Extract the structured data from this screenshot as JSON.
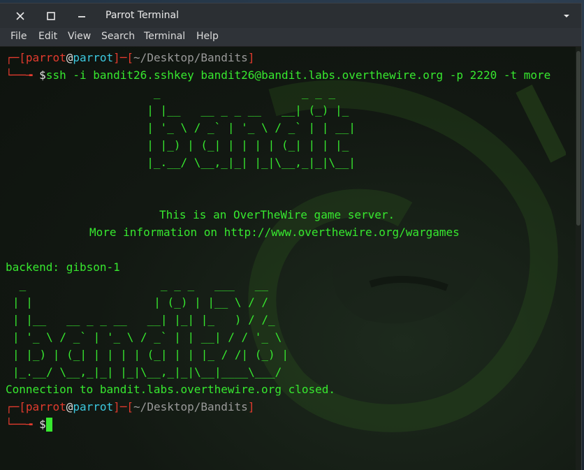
{
  "window": {
    "title": "Parrot Terminal",
    "close_icon": "close-icon",
    "maximize_icon": "maximize-icon",
    "minimize_icon": "minimize-icon",
    "menu_icon": "chevron-down-icon"
  },
  "menu": {
    "file": "File",
    "edit": "Edit",
    "view": "View",
    "search": "Search",
    "terminal": "Terminal",
    "help": "Help"
  },
  "prompt1": {
    "user": "parrot",
    "at": "@",
    "host": "parrot",
    "path": "~/Desktop/Bandits",
    "command": "ssh -i bandit26.sshkey bandit26@bandit.labs.overthewire.org -p 2220 -t more"
  },
  "banner_art": [
    "                      _                     _ _ _",
    "                     | |__   __ _ _ __   __| (_) |_",
    "                     | '_ \\ / _` | '_ \\ / _` | | __|",
    "                     | |_) | (_| | | | | (_| | | |_",
    "                     |_.__/ \\__,_|_| |_|\\__,_|_|\\__|"
  ],
  "server_msg": {
    "line1": "This is an OverTheWire game server.",
    "line2": "More information on http://www.overthewire.org/wargames"
  },
  "backend": "backend: gibson-1",
  "gibson_art": [
    " _                    _ _ _   ___   __",
    "| |                  | (_) | |__ \\ / /",
    "| |__   __ _ _ __   __| |_| |_   ) / /_",
    "| '_ \\ / _` | '_ \\ / _` | | __| / / '_ \\",
    "| |_) | (_| | | | | (_| | | |_ / /| (_) |",
    "|_.__/ \\__,_|_| |_|\\__,_|_|\\__|____\\___/"
  ],
  "closed_msg": "Connection to bandit.labs.overthewire.org closed.",
  "prompt2": {
    "user": "parrot",
    "at": "@",
    "host": "parrot",
    "path": "~/Desktop/Bandits",
    "symbol": "$"
  },
  "colors": {
    "prompt_bracket": "#e33b2e",
    "text_green": "#37e82f",
    "path_gray": "#9a9a9a"
  }
}
